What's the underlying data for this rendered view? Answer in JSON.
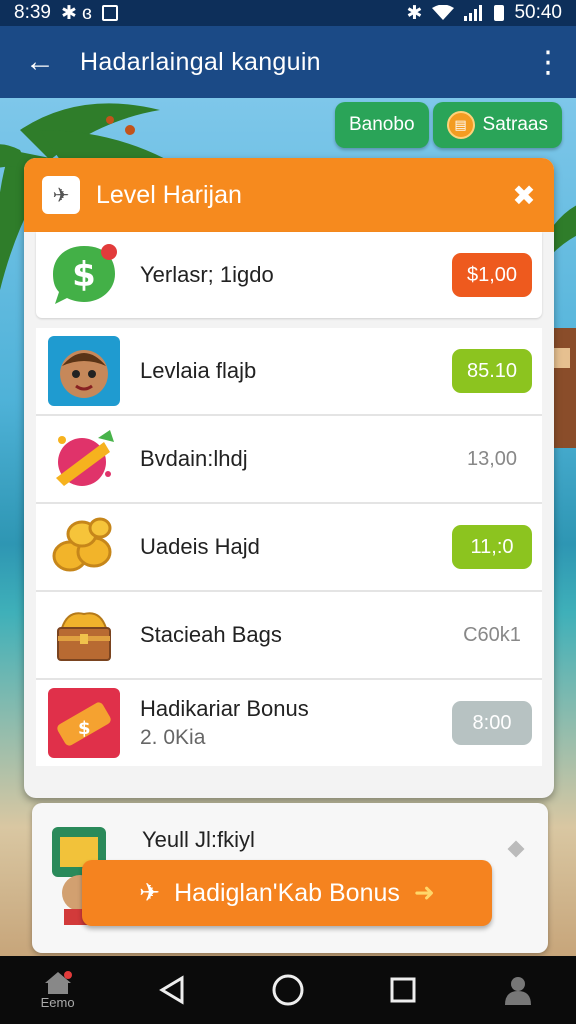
{
  "status_bar": {
    "time": "8:39",
    "left_glyphs": "✱ ɞ",
    "battery_time": "50:40"
  },
  "app_bar": {
    "title": "Hadarlaingal kanguin"
  },
  "top_buttons": [
    {
      "label": "Banobo"
    },
    {
      "label": "Satraas"
    }
  ],
  "panel": {
    "title": "Level Harijan"
  },
  "rows": [
    {
      "label": "Yerlasr; 1igdo",
      "sub": "",
      "value": "$1,00",
      "color": "#ee5a1e",
      "icon": "dollar-chat-icon"
    },
    {
      "label": "Levlaia flajb",
      "sub": "",
      "value": "85.10",
      "color": "#8cc41f",
      "icon": "avatar-face-icon"
    },
    {
      "label": "Bvdain:lhdj",
      "sub": "",
      "value": "13,00",
      "color": "",
      "icon": "gift-candy-icon"
    },
    {
      "label": "Uadeis Hajd",
      "sub": "",
      "value": "11,:0",
      "color": "#8cc41f",
      "icon": "gold-coins-icon"
    },
    {
      "label": "Stacieah Bags",
      "sub": "",
      "value": "C60k1",
      "color": "",
      "icon": "treasure-chest-icon"
    },
    {
      "label": "Hadikariar Bonus",
      "sub": "2. 0Kia",
      "value": "8:00",
      "color": "#b7c2c2",
      "icon": "ticket-icon"
    }
  ],
  "bottom_card": {
    "label": "Yeull Jl:fkiyl"
  },
  "cta": {
    "label": "Hadiglan'Kab Bonus"
  },
  "nav": {
    "home_label": "Eemo"
  }
}
